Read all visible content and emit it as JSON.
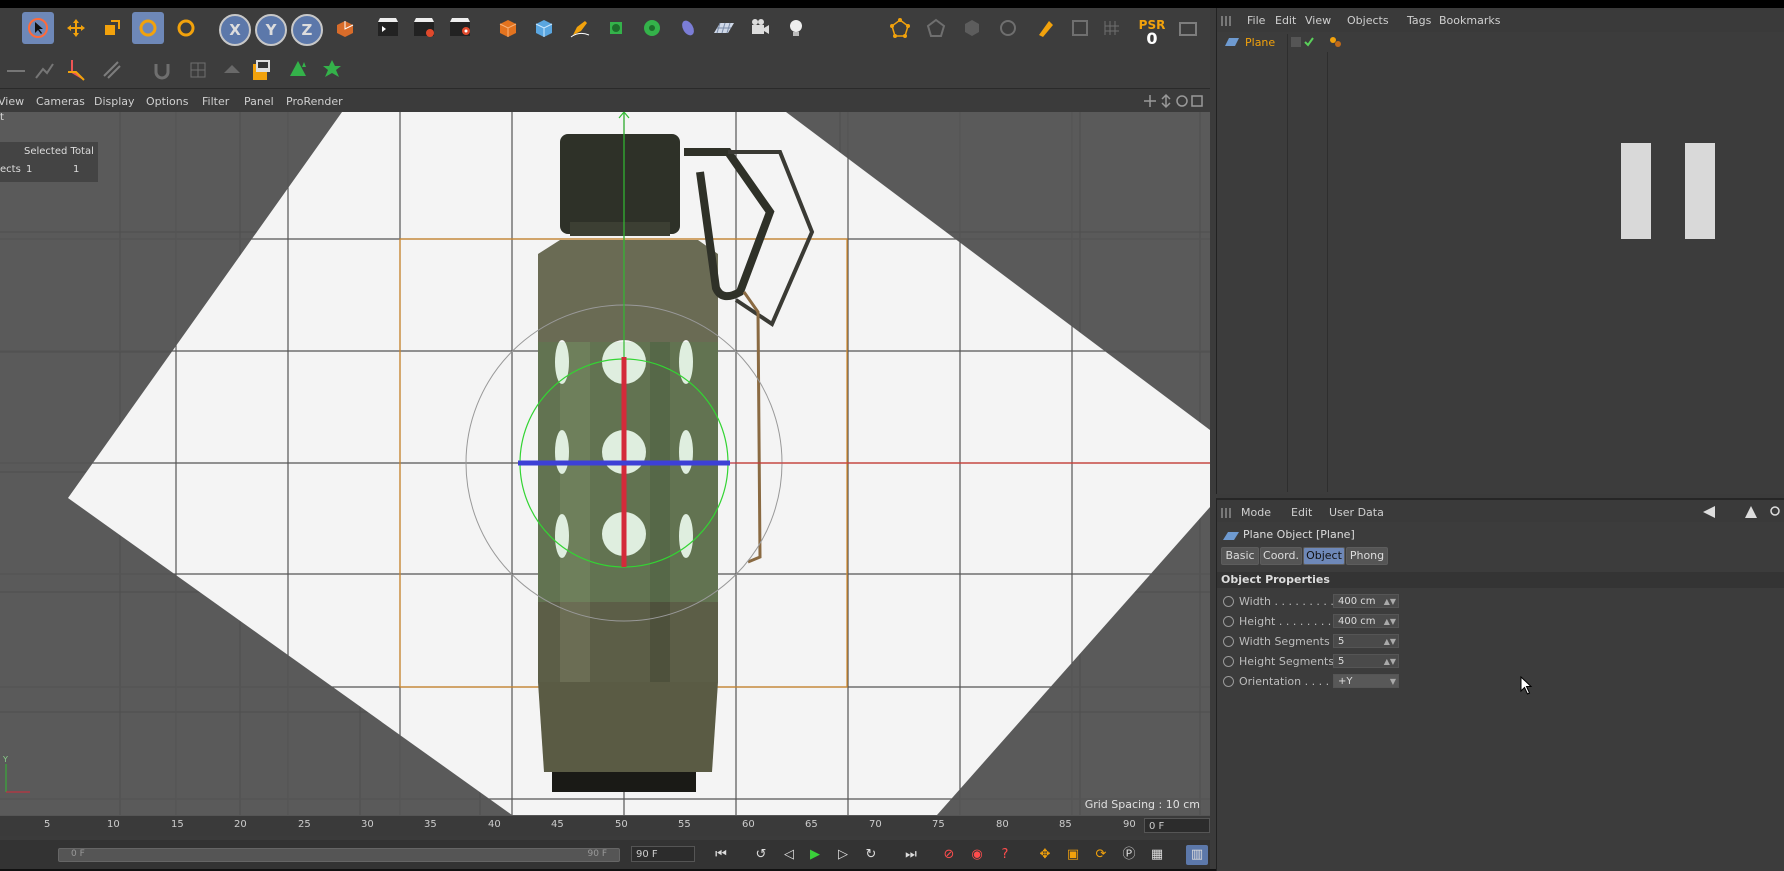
{
  "toolbar": {
    "psr_label": "PSR",
    "psr_value": "0",
    "axis_x": "X",
    "axis_y": "Y",
    "axis_z": "Z"
  },
  "viewport_menu": [
    "View",
    "Cameras",
    "Display",
    "Options",
    "Filter",
    "Panel",
    "ProRender"
  ],
  "viewport": {
    "title_fragment": "t",
    "stats_header": "Selected Total",
    "stats_row_label": "ects",
    "stats_selected": "1",
    "stats_total": "1",
    "grid_spacing": "Grid Spacing : 10 cm",
    "axis_y_label": "Y"
  },
  "timeline": {
    "ticks": [
      "5",
      "10",
      "15",
      "20",
      "25",
      "30",
      "35",
      "40",
      "45",
      "50",
      "55",
      "60",
      "65",
      "70",
      "75",
      "80",
      "85",
      "90"
    ],
    "current_frame": "0 F"
  },
  "transport": {
    "slider_start": "0 F",
    "slider_end": "90 F",
    "end_frame": "90 F"
  },
  "object_manager": {
    "menu": [
      "File",
      "Edit",
      "View",
      "Objects",
      "Tags",
      "Bookmarks"
    ],
    "object_name": "Plane"
  },
  "attributes": {
    "menu": [
      "Mode",
      "Edit",
      "User Data"
    ],
    "title": "Plane Object [Plane]",
    "tabs": [
      "Basic",
      "Coord.",
      "Object",
      "Phong"
    ],
    "active_tab": "Object",
    "section": "Object Properties",
    "props": [
      {
        "label": "Width . . . . . . . . .",
        "value": "400 cm"
      },
      {
        "label": "Height . . . . . . . .",
        "value": "400 cm"
      },
      {
        "label": "Width Segments",
        "value": "5"
      },
      {
        "label": "Height Segments",
        "value": "5"
      },
      {
        "label": "Orientation . . . .",
        "value": "+Y"
      }
    ]
  },
  "colors": {
    "accent": "#6e88b8",
    "psr": "#f2a20c",
    "object_name": "#f2a20c"
  }
}
